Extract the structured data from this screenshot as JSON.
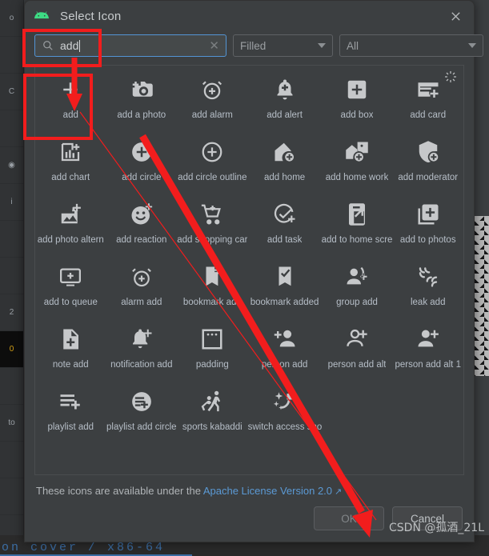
{
  "window": {
    "title": "Select Icon",
    "app_icon": "android-icon",
    "close_icon": "close-icon"
  },
  "search": {
    "icon": "search-icon",
    "value": "add",
    "clear_icon": "clear-icon"
  },
  "filters": {
    "style": {
      "value": "Filled",
      "chevron": "chevron-down-icon"
    },
    "category": {
      "value": "All",
      "chevron": "chevron-down-icon"
    }
  },
  "grid": {
    "loading_icon": "spinner-icon",
    "columns": 6,
    "selected": "add",
    "icons": [
      {
        "name": "add",
        "glyph": "plus"
      },
      {
        "name": "add a photo",
        "glyph": "camera-plus"
      },
      {
        "name": "add alarm",
        "glyph": "alarm-plus"
      },
      {
        "name": "add alert",
        "glyph": "bell-plus"
      },
      {
        "name": "add box",
        "glyph": "square-plus"
      },
      {
        "name": "add card",
        "glyph": "card-plus"
      },
      {
        "name": "add chart",
        "glyph": "chart-plus"
      },
      {
        "name": "add circle",
        "glyph": "circle-plus-filled"
      },
      {
        "name": "add circle outline",
        "glyph": "circle-plus-outline"
      },
      {
        "name": "add home",
        "glyph": "home-plus"
      },
      {
        "name": "add home work",
        "glyph": "home-work-plus"
      },
      {
        "name": "add moderator",
        "glyph": "shield-plus"
      },
      {
        "name": "add photo altern",
        "glyph": "photo-alt-plus"
      },
      {
        "name": "add reaction",
        "glyph": "face-plus"
      },
      {
        "name": "add shopping car",
        "glyph": "cart-plus"
      },
      {
        "name": "add task",
        "glyph": "check-circle-plus"
      },
      {
        "name": "add to home scre",
        "glyph": "phone-arrow"
      },
      {
        "name": "add to photos",
        "glyph": "stacked-plus"
      },
      {
        "name": "add to queue",
        "glyph": "tv-plus"
      },
      {
        "name": "alarm add",
        "glyph": "alarm-plus-outline"
      },
      {
        "name": "bookmark add",
        "glyph": "bookmark-plus"
      },
      {
        "name": "bookmark added",
        "glyph": "bookmark-check"
      },
      {
        "name": "group add",
        "glyph": "group-plus"
      },
      {
        "name": "leak add",
        "glyph": "leak-waves"
      },
      {
        "name": "note add",
        "glyph": "note-plus"
      },
      {
        "name": "notification add",
        "glyph": "notification-plus"
      },
      {
        "name": "padding",
        "glyph": "padding-square"
      },
      {
        "name": "person add",
        "glyph": "person-plus-left"
      },
      {
        "name": "person add alt",
        "glyph": "person-plus-outline"
      },
      {
        "name": "person add alt 1",
        "glyph": "person-plus-filled"
      },
      {
        "name": "playlist add",
        "glyph": "playlist-plus"
      },
      {
        "name": "playlist add circle",
        "glyph": "playlist-plus-circle"
      },
      {
        "name": "sports kabaddi",
        "glyph": "kabaddi"
      },
      {
        "name": "switch access sho",
        "glyph": "switch-access"
      }
    ]
  },
  "license": {
    "prefix": "These icons are available under the ",
    "link_text": "Apache License Version 2.0",
    "external_icon": "external-link-icon"
  },
  "buttons": {
    "ok": "OK",
    "cancel": "Cancel"
  },
  "watermark": "CSDN @孤酒_21L",
  "background": {
    "bottom_text": "on  cover / x86-64",
    "gutter_rows": [
      "o",
      "",
      "C",
      "",
      "◉",
      "i",
      "",
      "",
      "2",
      "0",
      "",
      "to",
      "",
      "",
      ""
    ]
  },
  "colors": {
    "dialog_bg": "#3c3f41",
    "focus_border": "#5394d4",
    "link": "#5b9ad5",
    "annotation": "#f21d1d",
    "android_green": "#3ddc84",
    "icon_fill": "#c6c8ca",
    "caption": "#b6bec7"
  }
}
